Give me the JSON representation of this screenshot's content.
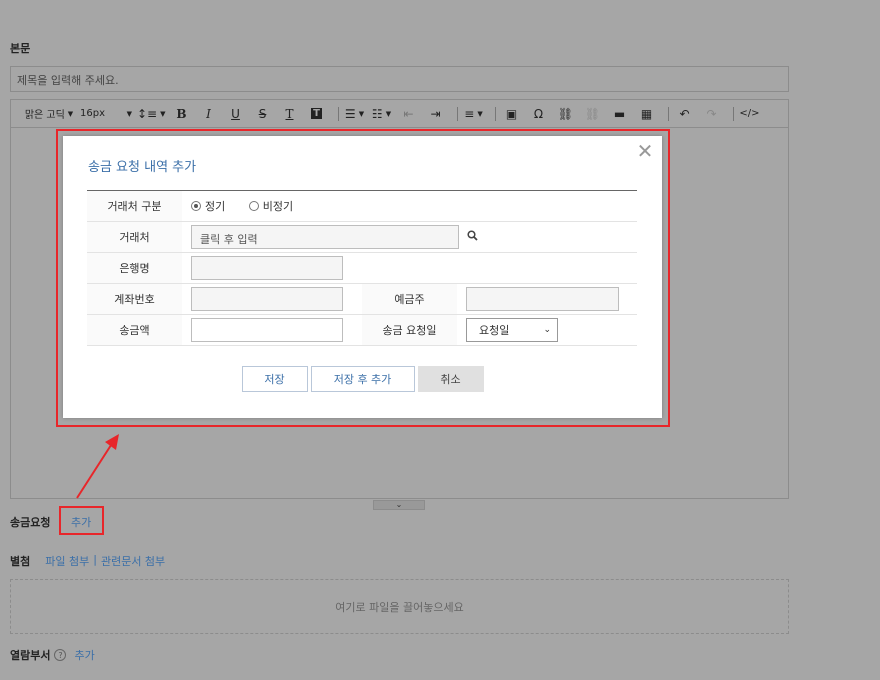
{
  "body_section": {
    "label": "본문",
    "title_placeholder": "제목을 입력해 주세요."
  },
  "toolbar": {
    "font_family": "맑은 고딕",
    "font_size": "16px",
    "items": [
      "line-height",
      "bold",
      "italic",
      "underline",
      "strikethrough",
      "text-color",
      "background-color",
      "bullet-list",
      "numbered-list",
      "outdent",
      "indent",
      "align",
      "image",
      "special-char",
      "link",
      "unlink",
      "horizontal-rule",
      "table",
      "undo",
      "redo",
      "source-code"
    ]
  },
  "modal": {
    "title": "송금 요청 내역 추가",
    "fields": {
      "client_type_label": "거래처 구분",
      "client_type_options": [
        "정기",
        "비정기"
      ],
      "client_type_selected": "정기",
      "client_label": "거래처",
      "client_placeholder": "클릭 후 입력",
      "bank_label": "은행명",
      "account_label": "계좌번호",
      "depositor_label": "예금주",
      "amount_label": "송금액",
      "request_date_label": "송금 요청일",
      "request_date_value": "요청일"
    },
    "buttons": {
      "save": "저장",
      "save_and_add": "저장 후 추가",
      "cancel": "취소"
    }
  },
  "remit_request": {
    "label": "송금요청",
    "add_link": "추가"
  },
  "attachment": {
    "label": "별첨",
    "file_attach": "파일 첨부",
    "separator": "|",
    "related_docs": "관련문서 첨부",
    "dropzone_text": "여기로 파일을 끌어놓으세요"
  },
  "readers": {
    "label": "열람부서",
    "help_icon": "?",
    "add_link": "추가"
  },
  "colors": {
    "overlay_bg": "#a6a6a6",
    "highlight": "#e8262a",
    "link": "#3b6fa8"
  }
}
